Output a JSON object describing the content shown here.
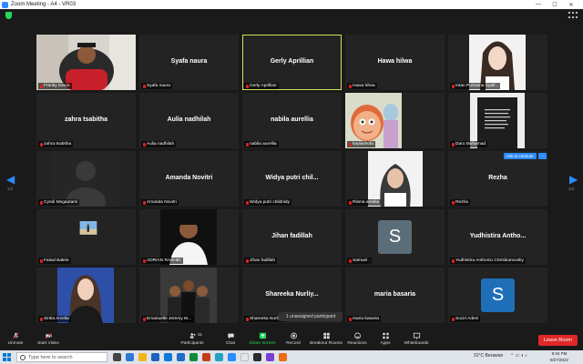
{
  "window": {
    "title": "Zoom Meeting - A4 - VR03",
    "controls": [
      "—",
      "☐",
      "✕"
    ]
  },
  "participants": [
    {
      "name": "Franky Dinno",
      "display": "",
      "photo": "man-red"
    },
    {
      "name": "Syafa naura",
      "display": "Syafa naura"
    },
    {
      "name": "Gerly Aprillian",
      "display": "Gerly Aprillian",
      "active": true
    },
    {
      "name": "Hawa hilwa",
      "display": "Hawa hilwa"
    },
    {
      "name": "Intan Purnama Syafi...",
      "display": "",
      "photo": "woman-light"
    },
    {
      "name": "zahra tsabitha",
      "display": "zahra tsabitha"
    },
    {
      "name": "Aulia nadhilah",
      "display": "Aulia nadhilah"
    },
    {
      "name": "nabila aurellia",
      "display": "nabila aurellia"
    },
    {
      "name": "kaylashofa",
      "display": "",
      "photo": "cartoon"
    },
    {
      "name": "Daru Muhamad",
      "display": "",
      "photo": "dark-shirt"
    },
    {
      "name": "Cyndi Megautami",
      "display": "",
      "photo": "silhouette"
    },
    {
      "name": "Amanda Novitri",
      "display": "Amanda Novitri"
    },
    {
      "name": "Widya putri childnidy",
      "display": "Widya putri chil..."
    },
    {
      "name": "Risma amelia",
      "display": "",
      "photo": "hijab"
    },
    {
      "name": "Rezha",
      "display": "Rezha"
    },
    {
      "name": "Faisal Bakrie",
      "display": "",
      "photo": "beach"
    },
    {
      "name": "ADRIAN RASHID",
      "display": "",
      "photo": "man-white"
    },
    {
      "name": "Jihan fadillah",
      "display": "Jihan fadillah"
    },
    {
      "name": "Samuel .",
      "display": "",
      "avatar": "S"
    },
    {
      "name": "Yudhistira Anthonio Chrisbianovsky",
      "display": "Yudhistira Antho..."
    },
    {
      "name": "Sintia Amelia",
      "display": "",
      "photo": "woman-blue"
    },
    {
      "name": "Emanuelle Jeremy M...",
      "display": "",
      "photo": "group"
    },
    {
      "name": "Shareeka Nurliy...",
      "display": "Shareeka Nurliy..."
    },
    {
      "name": "maria basaria",
      "display": "maria basaria"
    },
    {
      "name": "Suciri Adeni",
      "display": "",
      "avatar": "S",
      "blue": true
    }
  ],
  "page": {
    "left": "2/2",
    "right": "2/2"
  },
  "ask_to_unmute": "Ask to Unmute",
  "more": "···",
  "unassigned": "1 unassigned participant",
  "toolbar": {
    "unmute": "Unmute",
    "start_video": "Start Video",
    "participants": "Participants",
    "participants_count": "31",
    "chat": "Chat",
    "share_screen": "Share Screen",
    "record": "Record",
    "breakout": "Breakout Rooms",
    "reactions": "Reactions",
    "apps": "Apps",
    "whiteboards": "Whiteboards",
    "leave": "Leave Room"
  },
  "taskbar": {
    "search_placeholder": "Type here to search",
    "weather": "31°C  Berawan",
    "time": "9:34 PM",
    "date": "9/27/2022"
  },
  "colors": {
    "accent": "#2d8cff",
    "active_border": "#d4e157",
    "leave": "#e02828",
    "share": "#23d959"
  }
}
